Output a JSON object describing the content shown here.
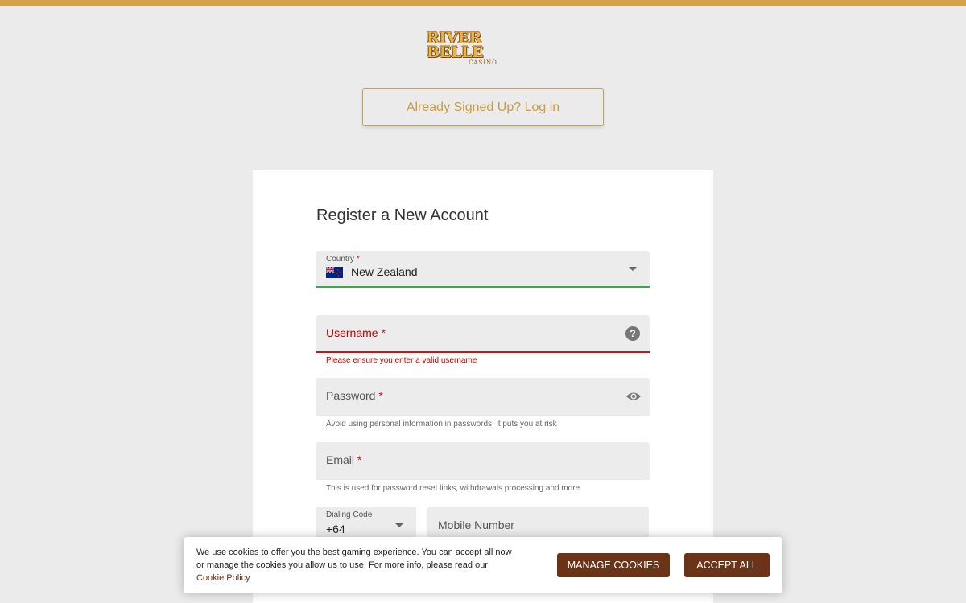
{
  "brand": {
    "logo_text": "RIVER BELLE",
    "logo_subtext": "CASINO",
    "accent_color": "#d6a14d"
  },
  "login": {
    "label": "Already Signed Up? Log in"
  },
  "form": {
    "title": "Register a New Account",
    "required_marker": "*",
    "country": {
      "label": "Country",
      "value": "New Zealand",
      "flag_icon": "new-zealand-flag-icon"
    },
    "username": {
      "label": "Username",
      "error": "Please ensure you enter a valid username",
      "help_icon": "?"
    },
    "password": {
      "label": "Password",
      "hint": "Avoid using personal information in passwords, it puts you at risk"
    },
    "email": {
      "label": "Email",
      "hint": "This is used for password reset links, withdrawals processing and more"
    },
    "dialing_code": {
      "label": "Dialing Code",
      "value": "+64"
    },
    "mobile": {
      "label": "Mobile Number"
    }
  },
  "cookies": {
    "text": "We use cookies to offer you the best gaming experience. You can accept all now or manage the cookies you allow us to use. For more info, please read our",
    "link": "Cookie Policy",
    "manage_label": "MANAGE COOKIES",
    "accept_label": "ACCEPT ALL",
    "button_color": "#6b3318"
  },
  "colors": {
    "valid": "#3aa845",
    "error": "#d31111"
  }
}
